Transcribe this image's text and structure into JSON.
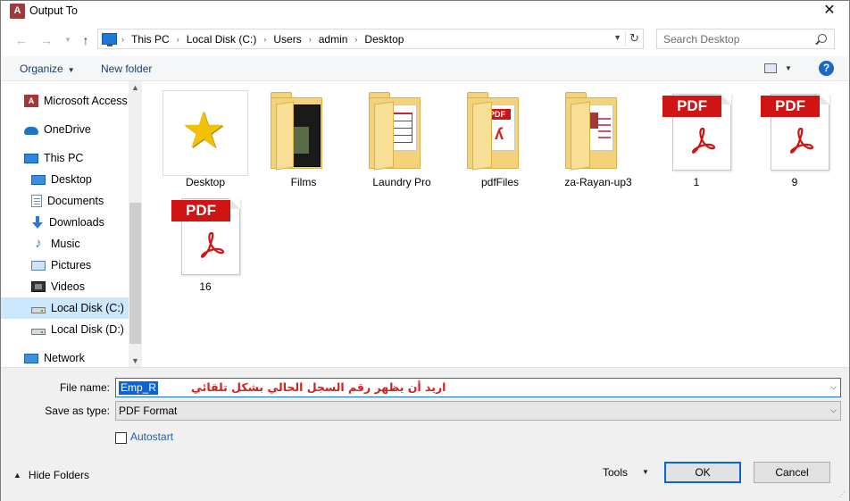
{
  "window": {
    "title": "Output To",
    "app_icon": "access-icon",
    "app_icon_letter": "A"
  },
  "address": {
    "crumbs": [
      "This PC",
      "Local Disk (C:)",
      "Users",
      "admin",
      "Desktop"
    ],
    "search_placeholder": "Search Desktop"
  },
  "toolbar": {
    "organize": "Organize",
    "new_folder": "New folder",
    "help": "?"
  },
  "nav": {
    "items": [
      {
        "label": "Microsoft Access",
        "icon": "access-icon"
      },
      {
        "label": "OneDrive",
        "icon": "cloud-icon"
      },
      {
        "label": "This PC",
        "icon": "pc-icon"
      },
      {
        "label": "Desktop",
        "icon": "desktop-icon"
      },
      {
        "label": "Documents",
        "icon": "documents-icon"
      },
      {
        "label": "Downloads",
        "icon": "download-icon"
      },
      {
        "label": "Music",
        "icon": "music-icon"
      },
      {
        "label": "Pictures",
        "icon": "pictures-icon"
      },
      {
        "label": "Videos",
        "icon": "videos-icon"
      },
      {
        "label": "Local Disk (C:)",
        "icon": "disk-icon",
        "selected": true
      },
      {
        "label": "Local Disk (D:)",
        "icon": "disk-icon"
      },
      {
        "label": "Network",
        "icon": "network-icon"
      }
    ]
  },
  "files": [
    {
      "label": "Desktop",
      "kind": "desktop"
    },
    {
      "label": "Films",
      "kind": "folder-films"
    },
    {
      "label": "Laundry Pro",
      "kind": "folder-laundry"
    },
    {
      "label": "pdfFiles",
      "kind": "folder-pdf"
    },
    {
      "label": "za-Rayan-up3",
      "kind": "folder-access"
    },
    {
      "label": "1",
      "kind": "pdf"
    },
    {
      "label": "9",
      "kind": "pdf"
    },
    {
      "label": "16",
      "kind": "pdf"
    }
  ],
  "pdf_badge": "PDF",
  "form": {
    "filename_label": "File name:",
    "filename_value": "Emp_R",
    "filename_note": "اريد أن يظهر رقم السجل الحالي بشكل تلقائي",
    "type_label": "Save as type:",
    "type_value": "PDF Format",
    "autostart_label": "Autostart"
  },
  "footer": {
    "hide_folders": "Hide Folders",
    "tools": "Tools",
    "ok": "OK",
    "cancel": "Cancel"
  },
  "colors": {
    "accent": "#0a64d6",
    "pdf_red": "#d01414",
    "folder": "#f3d27a",
    "note_red": "#d12020"
  }
}
